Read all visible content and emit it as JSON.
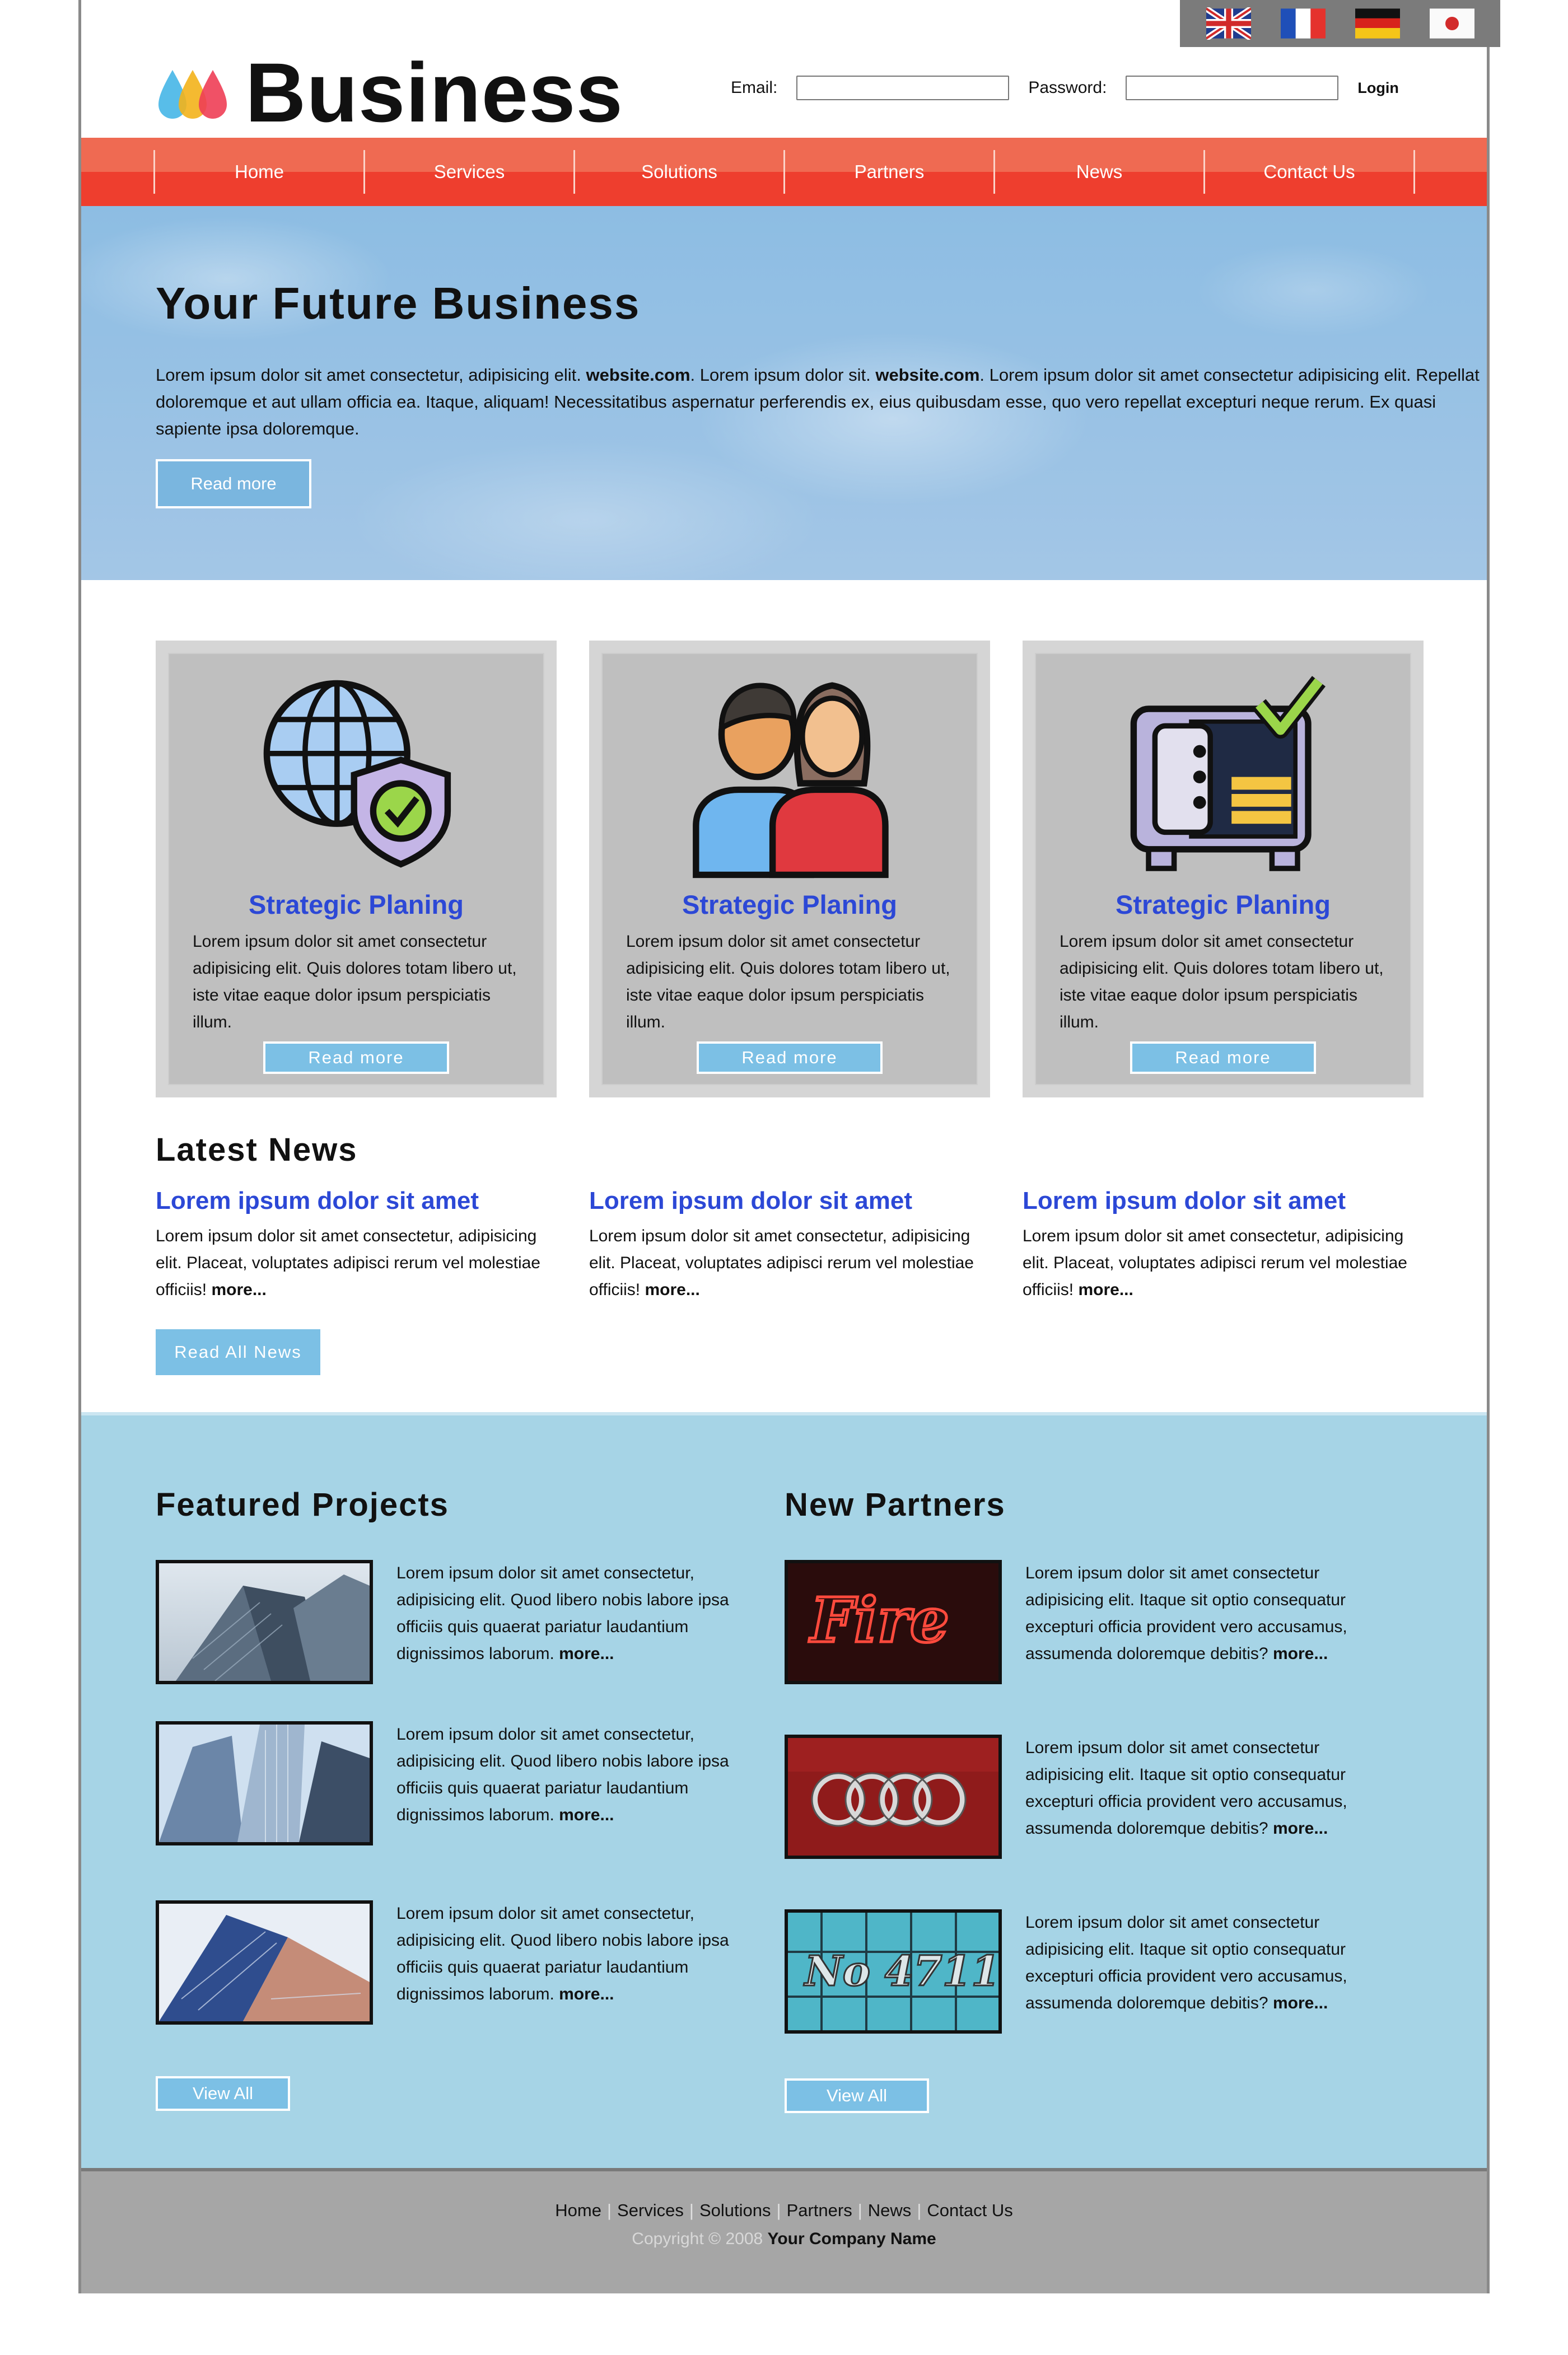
{
  "header": {
    "logo_text": "Business",
    "email_label": "Email:",
    "password_label": "Password:",
    "email_value": "",
    "password_value": "",
    "login_label": "Login",
    "flags": [
      "uk-flag-icon",
      "france-flag-icon",
      "germany-flag-icon",
      "japan-flag-icon"
    ]
  },
  "nav": {
    "items": [
      "Home",
      "Services",
      "Solutions",
      "Partners",
      "News",
      "Contact Us"
    ]
  },
  "hero": {
    "title": "Your Future Business",
    "text_1": "Lorem ipsum dolor sit amet consectetur, adipisicing elit. ",
    "bold_1": "website.com",
    "text_2": ". Lorem ipsum dolor sit. ",
    "bold_2": "website.com",
    "text_3": ". Lorem ipsum dolor sit amet consectetur adipisicing elit. Repellat doloremque et aut ullam officia ea. Itaque, aliquam! Necessitatibus aspernatur perferendis ex, eius quibusdam esse, quo vero repellat excepturi neque rerum. Ex quasi sapiente ipsa doloremque.",
    "button": "Read more"
  },
  "features": [
    {
      "icon": "globe-shield-icon",
      "title": "Strategic Planing",
      "text": "Lorem ipsum dolor sit amet consectetur adipisicing elit. Quis dolores totam libero ut, iste vitae eaque dolor ipsum perspiciatis illum.",
      "button": "Read more"
    },
    {
      "icon": "team-icon",
      "title": "Strategic Planing",
      "text": "Lorem ipsum dolor sit amet consectetur adipisicing elit. Quis dolores totam libero ut, iste vitae eaque dolor ipsum perspiciatis illum.",
      "button": "Read more"
    },
    {
      "icon": "safe-check-icon",
      "title": "Strategic Planing",
      "text": "Lorem ipsum dolor sit amet consectetur adipisicing elit. Quis dolores totam libero ut, iste vitae eaque dolor ipsum perspiciatis illum.",
      "button": "Read more"
    }
  ],
  "news": {
    "title": "Latest News",
    "items": [
      {
        "title": "Lorem ipsum dolor sit amet",
        "text": "Lorem ipsum dolor sit amet consectetur, adipisicing elit. Placeat, voluptates adipisci rerum vel molestiae officiis! ",
        "more": "more..."
      },
      {
        "title": "Lorem ipsum dolor sit amet",
        "text": "Lorem ipsum dolor sit amet consectetur, adipisicing elit. Placeat, voluptates adipisci rerum vel molestiae officiis! ",
        "more": "more..."
      },
      {
        "title": "Lorem ipsum dolor sit amet",
        "text": "Lorem ipsum dolor sit amet consectetur, adipisicing elit. Placeat, voluptates adipisci rerum vel molestiae officiis! ",
        "more": "more..."
      }
    ],
    "button": "Read All News"
  },
  "projects": {
    "title": "Featured Projects",
    "items": [
      {
        "text": "Lorem ipsum dolor sit amet consectetur, adipisicing elit. Quod libero nobis labore ipsa officiis quis quaerat pariatur laudantium dignissimos laborum. ",
        "more": "more..."
      },
      {
        "text": "Lorem ipsum dolor sit amet consectetur, adipisicing elit. Quod libero nobis labore ipsa officiis quis quaerat pariatur laudantium dignissimos laborum. ",
        "more": "more..."
      },
      {
        "text": "Lorem ipsum dolor sit amet consectetur, adipisicing elit. Quod libero nobis labore ipsa officiis quis quaerat pariatur laudantium dignissimos laborum. ",
        "more": "more..."
      }
    ],
    "button": "View All"
  },
  "partners": {
    "title": "New Partners",
    "items": [
      {
        "text": "Lorem ipsum dolor sit amet consectetur adipisicing elit. Itaque sit optio consequatur excepturi officia provident vero accusamus, assumenda doloremque debitis? ",
        "more": "more..."
      },
      {
        "text": "Lorem ipsum dolor sit amet consectetur adipisicing elit. Itaque sit optio consequatur excepturi officia provident vero accusamus, assumenda doloremque debitis? ",
        "more": "more..."
      },
      {
        "text": "Lorem ipsum dolor sit amet consectetur adipisicing elit. Itaque sit optio consequatur excepturi officia provident vero accusamus, assumenda doloremque debitis? ",
        "more": "more..."
      }
    ],
    "fire_sign": "Fire",
    "number_sign": "No 4711",
    "button": "View All"
  },
  "footer": {
    "links": [
      "Home",
      "Services",
      "Solutions",
      "Partners",
      "News",
      "Contact Us"
    ],
    "copyright": "Copyright © 2008 ",
    "company": "Your Company Name"
  }
}
